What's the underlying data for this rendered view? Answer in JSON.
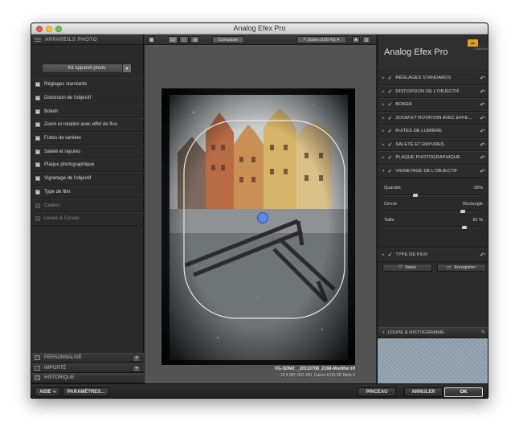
{
  "window": {
    "title": "Analog Efex Pro"
  },
  "left_panel": {
    "header": "APPAREILS PHOTO",
    "kit_select": "Kit appareil photo",
    "filters": [
      {
        "label": "Réglages standards",
        "checked": true
      },
      {
        "label": "Distorsion de l'objectif",
        "checked": true
      },
      {
        "label": "Bokeh",
        "checked": true
      },
      {
        "label": "Zoom et rotation avec effet de flou",
        "checked": true
      },
      {
        "label": "Fuites de lumière",
        "checked": true
      },
      {
        "label": "Saleté et rayures",
        "checked": true
      },
      {
        "label": "Plaque photographique",
        "checked": true
      },
      {
        "label": "Vignetage de l'objectif",
        "checked": true
      },
      {
        "label": "Type de film",
        "checked": true
      },
      {
        "label": "Cadres",
        "checked": false
      },
      {
        "label": "Levels & Curves",
        "checked": false
      }
    ],
    "bottom_sections": [
      {
        "label": "PERSONNALISÉ",
        "has_add": true
      },
      {
        "label": "IMPORTÉ",
        "has_add": true
      },
      {
        "label": "HISTORIQUE",
        "has_add": false
      }
    ]
  },
  "toolbar": {
    "compare_label": "Comparer",
    "zoom_label": "Zoom (100 %)"
  },
  "photo": {
    "filename": "VG-SDM2__20110708_2168-Modifier.tif",
    "info": "18,4 MP, ISO 100, Canon EOS 5D Mark II"
  },
  "right_panel": {
    "brand": "Analog Efex Pro",
    "logo_text": "nik",
    "collection": "Collection",
    "sections_top": [
      "RÉGLAGES STANDARDS",
      "DISTORSION DE L'OBJECTIF",
      "BOKEH",
      "ZOOM ET ROTATION AVEC EFFE...",
      "FUITES DE LUMIÈRE",
      "SALETÉ ET RAYURES",
      "PLAQUE PHOTOGRAPHIQUE"
    ],
    "vignette": {
      "header": "VIGNETAGE DE L'OBJECTIF",
      "amount_label": "Quantité",
      "amount_value": "-35%",
      "amount_fraction": 0.32,
      "shape_left": "Cercle",
      "shape_right": "Rectangle",
      "shape_fraction": 0.8,
      "size_label": "Taille",
      "size_value": "81 %",
      "size_fraction": 0.81
    },
    "film_type_header": "TYPE DE FILM",
    "vary_label": "Varier",
    "save_label": "Enregistrer",
    "loupe_header": "LOUPE & HISTOGRAMME"
  },
  "bottom_bar": {
    "help": "AIDE",
    "settings": "PARAMÈTRES...",
    "brush": "PINCEAU",
    "cancel": "ANNULER",
    "ok": "OK"
  }
}
